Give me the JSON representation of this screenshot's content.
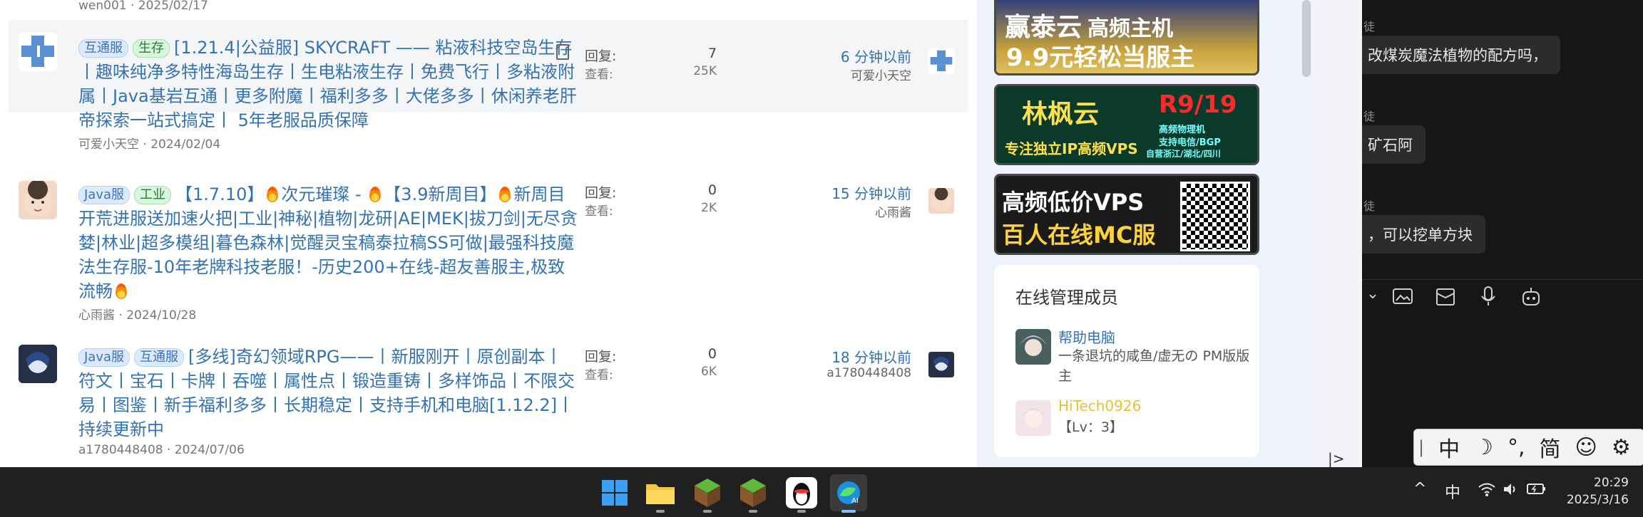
{
  "forum": {
    "prev_author": "wen001 · 2025/02/17",
    "labels": {
      "replies": "回复:",
      "views": "查看:"
    },
    "threads": [
      {
        "tags": [
          {
            "text": "互通服",
            "color": "blue"
          },
          {
            "text": "生存",
            "color": "green"
          }
        ],
        "title": "[1.21.4|公益服] SKYCRAFT —— 粘液科技空岛生存丨趣味纯净多特性海岛生存丨生电粘液生存丨免费飞行丨多粘液附属丨Java基岩互通丨更多附魔丨福利多多丨大佬多多丨休闲养老肝帝探索一站式搞定丨 5年老服品质保障",
        "author_date": "可爱小天空 · 2024/02/04",
        "replies": "7",
        "views": "25K",
        "last_time": "6 分钟以前",
        "last_user": "可爱小天空"
      },
      {
        "tags": [
          {
            "text": "Java服",
            "color": "blue"
          },
          {
            "text": "工业",
            "color": "green"
          }
        ],
        "title_parts": [
          "【1.7.10】",
          "次元璀璨 - ",
          "【3.9新周目】",
          "新周目开荒进服送加速火把|工业|神秘|植物|龙研|AE|MEK|拔刀剑|无尽贪婪|林业|超多模组|暮色森林|觉醒灵宝稿泰拉稿SS可做|最强科技魔法生存服-10年老牌科技老服！-历史200+在线-超友善服主,极致流畅"
        ],
        "author_date": "心雨酱 · 2024/10/28",
        "replies": "0",
        "views": "2K",
        "last_time": "15 分钟以前",
        "last_user": "心雨酱"
      },
      {
        "tags": [
          {
            "text": "Java服",
            "color": "blue"
          },
          {
            "text": "互通服",
            "color": "blue"
          }
        ],
        "title": "[多线]奇幻领域RPG——丨新服刚开丨原创副本丨符文丨宝石丨卡牌丨吞噬丨属性点丨锻造重铸丨多样饰品丨不限交易丨图鉴丨新手福利多多丨长期稳定丨支持手机和电脑[1.12.2]丨持续更新中",
        "author_date": "a1780448408 · 2024/07/06",
        "replies": "0",
        "views": "6K",
        "last_time": "18 分钟以前",
        "last_user": "a1780448408"
      }
    ]
  },
  "sidebar": {
    "banners": [
      {
        "line1": "赢泰云",
        "line1b": "高频主机",
        "line2": "9.9元轻松当服主"
      },
      {
        "line1": "林枫云",
        "line1b": "R9/19",
        "line2": "专注独立IP高频VPS",
        "small1": "高频物理机",
        "small2": "支持电信/BGP",
        "small3": "自营浙江/湖北/四川"
      },
      {
        "line1": "高频低价VPS",
        "line2": "百人在线MC服"
      }
    ],
    "admins_title": "在线管理成员",
    "admins": [
      {
        "name": "帮助电脑",
        "desc": "一条退坑的咸鱼/虚无の PM版版主",
        "name_color": "#3572b0"
      },
      {
        "name": "HiTech0926",
        "desc": "【Lv：3】",
        "name_color": "#e6c23a"
      }
    ],
    "collapse_glyph": "|>"
  },
  "chat": {
    "messages": [
      {
        "name": "徒",
        "text": "改煤炭魔法植物的配方吗，"
      },
      {
        "name": "徒",
        "text": "矿石阿"
      },
      {
        "name": "徒",
        "text": "，可以挖单方块"
      }
    ],
    "chevron": "⌄"
  },
  "ime": {
    "items": [
      "中",
      "☽",
      "°,",
      "简",
      "☺",
      "⚙"
    ]
  },
  "taskbar": {
    "tray": {
      "chevron": "^",
      "lang": "中"
    },
    "time": "20:29",
    "date": "2025/3/16"
  }
}
